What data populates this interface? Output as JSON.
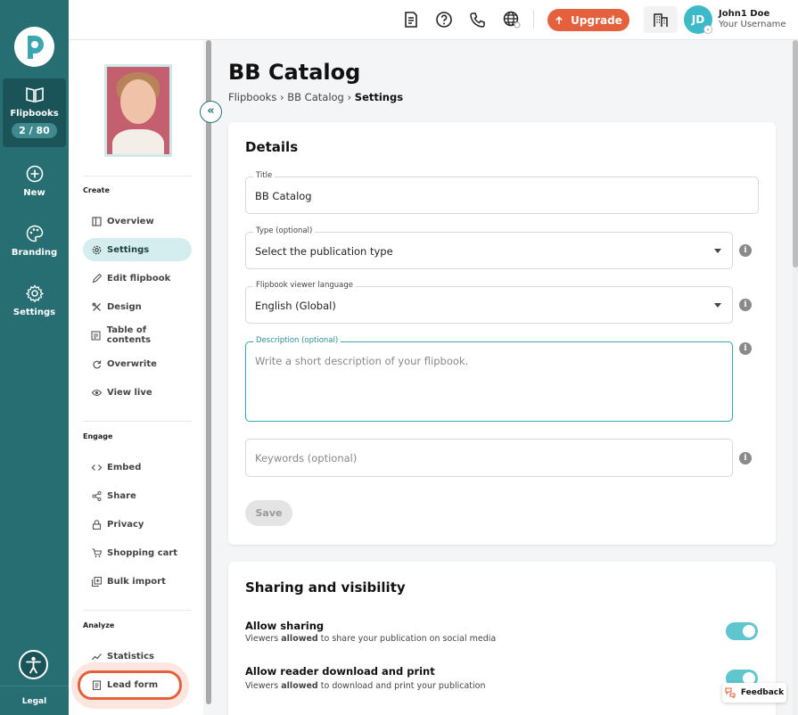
{
  "rail": {
    "items": [
      {
        "label": "Flipbooks",
        "badge": "2 / 80"
      },
      {
        "label": "New"
      },
      {
        "label": "Branding"
      },
      {
        "label": "Settings"
      }
    ],
    "legal": "Legal"
  },
  "topbar": {
    "upgrade_label": "Upgrade",
    "avatar_initials": "JD",
    "user_name": "John1 Doe",
    "user_sub": "Your Username"
  },
  "sidebar": {
    "sections": {
      "create": "Create",
      "engage": "Engage",
      "analyze": "Analyze"
    },
    "create_items": [
      {
        "label": "Overview",
        "icon": "layout-icon"
      },
      {
        "label": "Settings",
        "icon": "gear-icon"
      },
      {
        "label": "Edit flipbook",
        "icon": "pencil-icon"
      },
      {
        "label": "Design",
        "icon": "design-icon"
      },
      {
        "label": "Table of contents",
        "icon": "toc-icon"
      },
      {
        "label": "Overwrite",
        "icon": "refresh-icon"
      },
      {
        "label": "View live",
        "icon": "eye-icon"
      }
    ],
    "engage_items": [
      {
        "label": "Embed",
        "icon": "code-icon"
      },
      {
        "label": "Share",
        "icon": "share-icon"
      },
      {
        "label": "Privacy",
        "icon": "lock-icon"
      },
      {
        "label": "Shopping cart",
        "icon": "cart-icon"
      },
      {
        "label": "Bulk import",
        "icon": "bulk-import-icon"
      }
    ],
    "analyze_items": [
      {
        "label": "Statistics",
        "icon": "chart-line-icon"
      },
      {
        "label": "Lead form",
        "icon": "form-icon"
      }
    ]
  },
  "main": {
    "title": "BB Catalog",
    "breadcrumb": [
      "Flipbooks",
      "BB Catalog",
      "Settings"
    ],
    "details": {
      "heading": "Details",
      "title_label": "Title",
      "title_value": "BB Catalog",
      "type_label": "Type (optional)",
      "type_value": "Select the publication type",
      "language_label": "Flipbook viewer language",
      "language_value": "English (Global)",
      "description_label": "Description (optional)",
      "description_placeholder": "Write a short description of your flipbook.",
      "keywords_placeholder": "Keywords (optional)",
      "save_label": "Save"
    },
    "sharing": {
      "heading": "Sharing and visibility",
      "settings": [
        {
          "title": "Allow sharing",
          "desc_pre": "Viewers ",
          "desc_bold": "allowed",
          "desc_post": " to share your publication on social media",
          "on": true
        },
        {
          "title": "Allow reader download and print",
          "desc_pre": "Viewers ",
          "desc_bold": "allowed",
          "desc_post": " to download and print your publication",
          "on": true
        }
      ]
    }
  },
  "feedback_label": "Feedback",
  "colors": {
    "rail": "#276e73",
    "accent": "#e5603c",
    "toggle_on": "#5fc5ce",
    "active_nav": "#d4eef0"
  }
}
